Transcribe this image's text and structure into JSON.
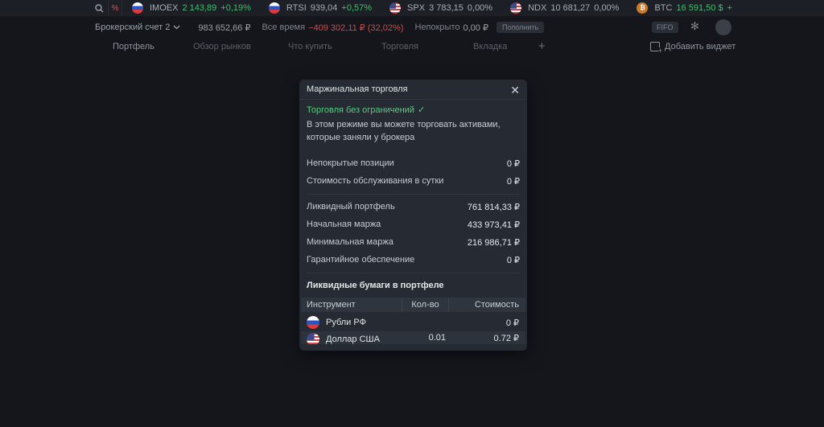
{
  "ticker": {
    "percent_label": "%",
    "items": [
      {
        "name": "IMOEX",
        "value": "2 143,89",
        "change": "+0,19%",
        "flag": "ru",
        "trend": "up"
      },
      {
        "name": "RTSI",
        "value": "939,04",
        "change": "+0,57%",
        "flag": "ru",
        "trend": "up"
      },
      {
        "name": "SPX",
        "value": "3 783,15",
        "change": "0,00%",
        "flag": "us",
        "trend": "flat"
      },
      {
        "name": "NDX",
        "value": "10 681,27",
        "change": "0,00%",
        "flag": "us",
        "trend": "flat"
      },
      {
        "name": "BTC",
        "value": "16 591,50 $",
        "change": "+",
        "flag": "btc",
        "trend": "up"
      }
    ]
  },
  "account": {
    "name": "Брокерский счет 2",
    "total": "983 652,66 ₽",
    "period_label": "Все время",
    "period_change": "−409 302,11 ₽ (32,02%)",
    "uncovered_label": "Непокрыто",
    "uncovered_value": "0,00 ₽",
    "topup_label": "Пополнить",
    "fifo_label": "FIFO"
  },
  "nav": {
    "tabs": [
      "Портфель",
      "Обзор рынков",
      "Что купить",
      "Торговля",
      "Вкладка"
    ],
    "active_tab": "Портфель",
    "add_widget_label": "Добавить виджет"
  },
  "modal": {
    "title": "Маржинальная торговля",
    "mode_status": "Торговля без ограничений",
    "mode_description": "В этом режиме вы можете торговать активами, которые заняли у брокера",
    "rows_top": [
      {
        "label": "Непокрытые позиции",
        "value": "0 ₽"
      },
      {
        "label": "Стоимость обслуживания в сутки",
        "value": "0 ₽"
      }
    ],
    "rows_mid": [
      {
        "label": "Ликвидный портфель",
        "value": "761 814,33 ₽"
      },
      {
        "label": "Начальная маржа",
        "value": "433 973,41 ₽"
      },
      {
        "label": "Минимальная маржа",
        "value": "216 986,71 ₽"
      },
      {
        "label": "Гарантийное обеспечение",
        "value": "0 ₽"
      }
    ],
    "liquid_title": "Ликвидные бумаги в портфеле",
    "table": {
      "headers": [
        "Инструмент",
        "Кол-во",
        "Стоимость"
      ],
      "rows": [
        {
          "instrument": "Рубли РФ",
          "qty": "",
          "cost": "0 ₽",
          "flag": "ru"
        },
        {
          "instrument": "Доллар США",
          "qty": "0.01",
          "cost": "0.72 ₽",
          "flag": "us"
        }
      ]
    }
  }
}
